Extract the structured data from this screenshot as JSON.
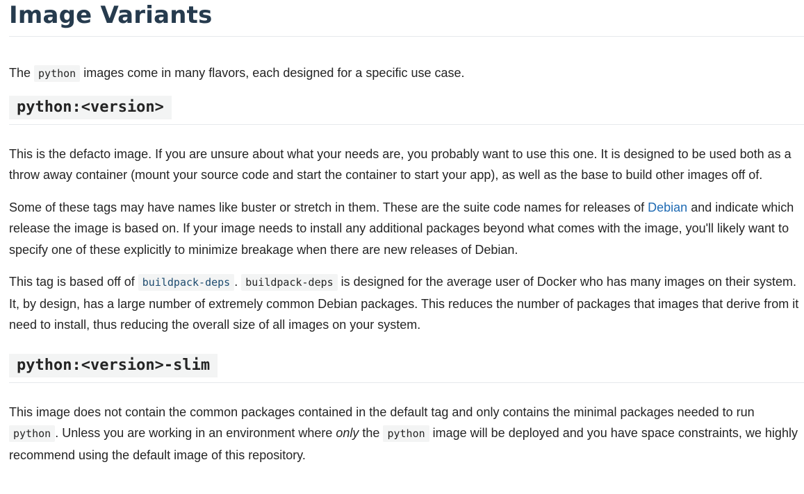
{
  "title": "Image Variants",
  "intro": {
    "pre": "The ",
    "code": "python",
    "post": " images come in many flavors, each designed for a specific use case."
  },
  "section1": {
    "heading": "python:<version>",
    "p1": "This is the defacto image. If you are unsure about what your needs are, you probably want to use this one. It is designed to be used both as a throw away container (mount your source code and start the container to start your app), as well as the base to build other images off of.",
    "p2_pre": "Some of these tags may have names like buster or stretch in them. These are the suite code names for releases of ",
    "p2_link": "Debian",
    "p2_post": " and indicate which release the image is based on. If your image needs to install any additional packages beyond what comes with the image, you'll likely want to specify one of these explicitly to minimize breakage when there are new releases of Debian.",
    "p3_pre": "This tag is based off of ",
    "p3_code1": "buildpack-deps",
    "p3_mid": ". ",
    "p3_code2": "buildpack-deps",
    "p3_post": " is designed for the average user of Docker who has many images on their system. It, by design, has a large number of extremely common Debian packages. This reduces the number of packages that images that derive from it need to install, thus reducing the overall size of all images on your system."
  },
  "section2": {
    "heading": "python:<version>-slim",
    "p1_pre": "This image does not contain the common packages contained in the default tag and only contains the minimal packages needed to run ",
    "p1_code1": "python",
    "p1_mid1": ". Unless you are working in an environment where ",
    "p1_em": "only",
    "p1_mid2": " the ",
    "p1_code2": "python",
    "p1_post": " image will be deployed and you have space constraints, we highly recommend using the default image of this repository."
  }
}
